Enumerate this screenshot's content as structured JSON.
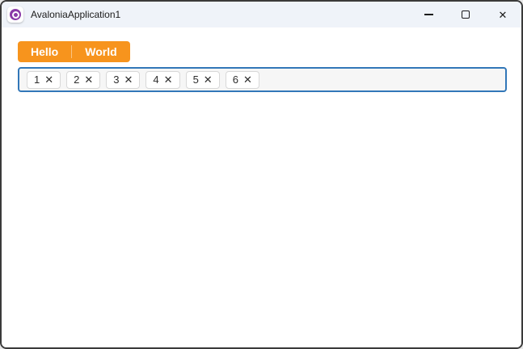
{
  "window": {
    "title": "AvaloniaApplication1",
    "controls": {
      "close_glyph": "✕"
    }
  },
  "toolbar": {
    "segments": [
      "Hello",
      "World"
    ]
  },
  "tagbox": {
    "items": [
      "1",
      "2",
      "3",
      "4",
      "5",
      "6"
    ],
    "remove_glyph": "✕"
  },
  "colors": {
    "accent_orange": "#F7941D",
    "focus_border": "#3277B8",
    "titlebar_bg": "#EFF3F9",
    "window_border": "#3A3A3A",
    "logo_purple": "#8A3BA8",
    "chip_bg": "#FFFFFF",
    "chip_border": "#D8D8D8",
    "tagbox_bg": "#F6F6F6"
  }
}
